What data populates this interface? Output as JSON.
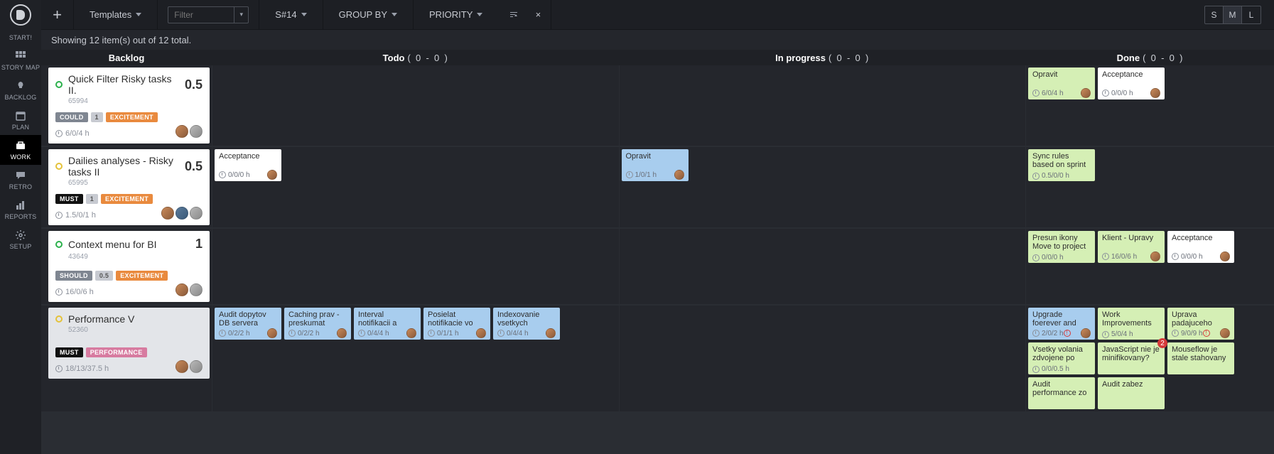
{
  "rail": {
    "start": "START!",
    "items": [
      {
        "label": "STORY MAP",
        "icon": "grid"
      },
      {
        "label": "BACKLOG",
        "icon": "bulb"
      },
      {
        "label": "PLAN",
        "icon": "calendar"
      },
      {
        "label": "WORK",
        "icon": "briefcase",
        "active": true
      },
      {
        "label": "RETRO",
        "icon": "chat"
      },
      {
        "label": "REPORTS",
        "icon": "bars"
      },
      {
        "label": "SETUP",
        "icon": "gear"
      }
    ]
  },
  "toolbar": {
    "templates": "Templates",
    "filter_placeholder": "Filter",
    "sprint": "S#14",
    "group_by": "GROUP BY",
    "priority": "PRIORITY",
    "close": "×",
    "sizes": [
      "S",
      "M",
      "L"
    ],
    "size_active": "M"
  },
  "info": "Showing 12 item(s) out of 12 total.",
  "columns": {
    "backlog": "Backlog",
    "todo": {
      "name": "Todo",
      "a": "0",
      "b": "0"
    },
    "progress": {
      "name": "In progress",
      "a": "0",
      "b": "0"
    },
    "done": {
      "name": "Done",
      "a": "0",
      "b": "0"
    }
  },
  "rows": [
    {
      "story": {
        "bullet": "green",
        "title": "Quick Filter Risky tasks II.",
        "id": "65994",
        "points": "0.5",
        "badges": [
          {
            "t": "could",
            "v": "COULD"
          },
          {
            "t": "num",
            "v": "1"
          },
          {
            "t": "excite",
            "v": "EXCITEMENT"
          }
        ],
        "time": "6/0/4 h",
        "avatars": [
          "a",
          "c"
        ]
      },
      "todo": [],
      "progress": [],
      "done": [
        {
          "c": "green",
          "title": "Opravit",
          "time": "6/0/4 h",
          "av": "a"
        },
        {
          "c": "white",
          "title": "Acceptance",
          "time": "0/0/0 h",
          "av": "a"
        }
      ]
    },
    {
      "story": {
        "bullet": "yellow",
        "title": "Dailies analyses - Risky tasks II",
        "id": "65995",
        "points": "0.5",
        "badges": [
          {
            "t": "must",
            "v": "MUST"
          },
          {
            "t": "num",
            "v": "1"
          },
          {
            "t": "excite",
            "v": "EXCITEMENT"
          }
        ],
        "time": "1.5/0/1 h",
        "avatars": [
          "a",
          "b",
          "c"
        ]
      },
      "todo": [
        {
          "c": "white",
          "title": "Acceptance",
          "time": "0/0/0 h",
          "av": "a"
        }
      ],
      "progress": [
        {
          "c": "blue",
          "title": "Opravit",
          "time": "1/0/1 h",
          "av": "a"
        }
      ],
      "done": [
        {
          "c": "green",
          "title": "Sync rules based on sprint due change",
          "time": "0.5/0/0 h",
          "av": ""
        }
      ]
    },
    {
      "story": {
        "bullet": "green",
        "title": "Context menu for BI",
        "id": "43649",
        "points": "1",
        "badges": [
          {
            "t": "should",
            "v": "SHOULD"
          },
          {
            "t": "num",
            "v": "0.5"
          },
          {
            "t": "excite",
            "v": "EXCITEMENT"
          }
        ],
        "time": "16/0/6 h",
        "avatars": [
          "a",
          "c"
        ]
      },
      "todo": [],
      "progress": [],
      "done": [
        {
          "c": "green",
          "title": "Presun ikony Move to project",
          "time": "0/0/0 h",
          "av": ""
        },
        {
          "c": "green",
          "title": "Klient - Upravy",
          "time": "16/0/6 h",
          "av": "a"
        },
        {
          "c": "white",
          "title": "Acceptance",
          "time": "0/0/0 h",
          "av": "a"
        }
      ]
    },
    {
      "story": {
        "gray": true,
        "bullet": "yellow",
        "title": "Performance V",
        "id": "52360",
        "points": "",
        "badges": [
          {
            "t": "must",
            "v": "MUST"
          },
          {
            "t": "perf",
            "v": "PERFORMANCE"
          }
        ],
        "time": "18/13/37.5 h",
        "avatars": [
          "a",
          "c"
        ]
      },
      "todo": [
        {
          "c": "blue",
          "title": "Audit dopytov DB servera",
          "time": "0/2/2 h",
          "av": "a"
        },
        {
          "c": "blue",
          "title": "Caching prav - preskumat",
          "time": "0/2/2 h",
          "av": "a"
        },
        {
          "c": "blue",
          "title": "Interval notifikacii a emailov",
          "time": "0/4/4 h",
          "av": "a"
        },
        {
          "c": "blue",
          "title": "Posielat notifikacie vo fork",
          "time": "0/1/1 h",
          "av": "a"
        },
        {
          "c": "blue",
          "title": "Indexovanie vsetkych atributov",
          "time": "0/4/4 h",
          "av": "a"
        }
      ],
      "progress": [],
      "done": [
        {
          "c": "blue",
          "title": "Upgrade foerever and nodejs",
          "time": "2/0/2 h",
          "av": "a",
          "alert": true
        },
        {
          "c": "green",
          "title": "Work Improvements",
          "time": "5/0/4 h",
          "av": ""
        },
        {
          "c": "green",
          "title": "Uprava padajuceho socketu + analyza",
          "time": "9/0/9 h",
          "av": "a",
          "alert": true
        },
        {
          "c": "green",
          "title": "Vsetky volania zdvojene po",
          "time": "0/0/0.5 h",
          "av": ""
        },
        {
          "c": "green",
          "title": "JavaScript nie je minifikovany?",
          "time": "",
          "av": "",
          "notif": "2"
        },
        {
          "c": "green",
          "title": "Mouseflow je stale stahovany",
          "time": "",
          "av": ""
        },
        {
          "c": "green",
          "title": "Audit performance zo servera",
          "time": "",
          "av": ""
        },
        {
          "c": "green",
          "title": "Audit zabez",
          "time": "",
          "av": ""
        }
      ]
    }
  ]
}
